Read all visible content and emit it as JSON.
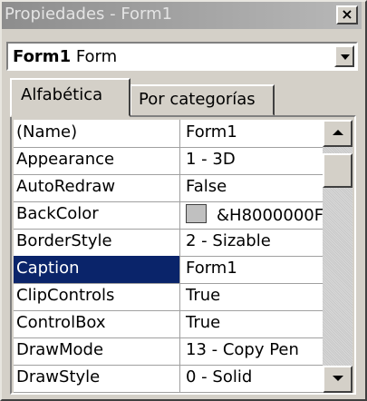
{
  "window": {
    "title": "Propiedades - Form1"
  },
  "object_selector": {
    "name": "Form1",
    "type": "Form"
  },
  "tabs": [
    {
      "label": "Alfabética"
    },
    {
      "label": "Por categorías"
    }
  ],
  "properties": [
    {
      "name": "(Name)",
      "value": "Form1"
    },
    {
      "name": "Appearance",
      "value": "1 - 3D"
    },
    {
      "name": "AutoRedraw",
      "value": "False"
    },
    {
      "name": "BackColor",
      "value": "&H8000000F"
    },
    {
      "name": "BorderStyle",
      "value": "2 - Sizable"
    },
    {
      "name": "Caption",
      "value": "Form1"
    },
    {
      "name": "ClipControls",
      "value": "True"
    },
    {
      "name": "ControlBox",
      "value": "True"
    },
    {
      "name": "DrawMode",
      "value": "13 - Copy Pen"
    },
    {
      "name": "DrawStyle",
      "value": "0 - Solid"
    }
  ],
  "selected_property": "Caption",
  "colors": {
    "selection": "#0a246a",
    "backcolor_swatch": "#c0c0c0",
    "titlebar": "#8d8d8d"
  },
  "icons": {
    "close": "close-icon",
    "dropdown": "chevron-down-icon",
    "scroll_up": "arrow-up-icon",
    "scroll_down": "arrow-down-icon"
  }
}
